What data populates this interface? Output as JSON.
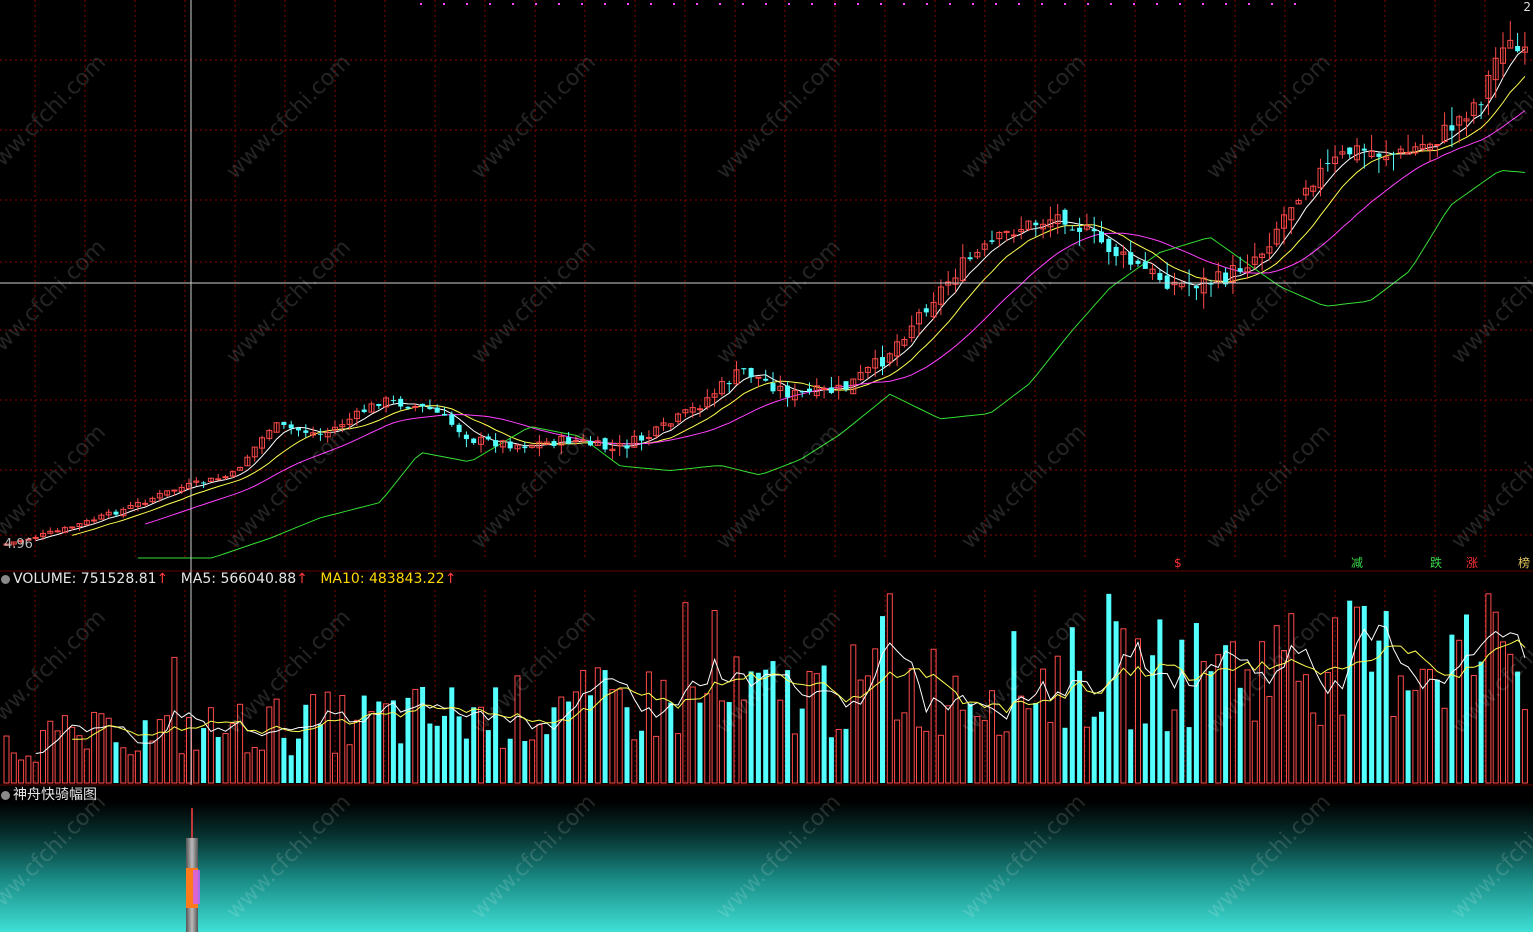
{
  "volume_header": {
    "volume_label": "VOLUME:",
    "volume_value": "751528.81",
    "ma5_label": "MA5:",
    "ma5_value": "566040.88",
    "ma10_label": "MA10:",
    "ma10_value": "483843.22",
    "arrow": "↑"
  },
  "indicator_panel": {
    "title": "神舟快骑幅图"
  },
  "price_axis": {
    "low_label": "4.96",
    "top_label": "2"
  },
  "signals": [
    {
      "text": "$",
      "color": "#ff3030"
    },
    {
      "text": "减",
      "color": "#39d84a"
    },
    {
      "text": "跌",
      "color": "#39d84a"
    },
    {
      "text": "涨",
      "color": "#ff3030"
    },
    {
      "text": "榜",
      "color": "#e2c45a"
    }
  ],
  "watermark": "www.cfchi.com",
  "colors": {
    "up": "#ff4a4a",
    "down": "#54ffff",
    "ma5": "#ffffff",
    "ma10": "#ffff50",
    "ma20": "#ff40ff",
    "ma60": "#35e035",
    "grid": "#8b0000",
    "crosshair": "#d0d0d0"
  },
  "chart_data": {
    "type": "candlestick",
    "indicators": [
      "MA5",
      "MA10",
      "MA20",
      "MA60",
      "VOLUME",
      "MA5",
      "MA10"
    ],
    "y_min_label": 4.96,
    "volume": {
      "last": 751528.81,
      "ma5": 566040.88,
      "ma10": 483843.22
    }
  }
}
